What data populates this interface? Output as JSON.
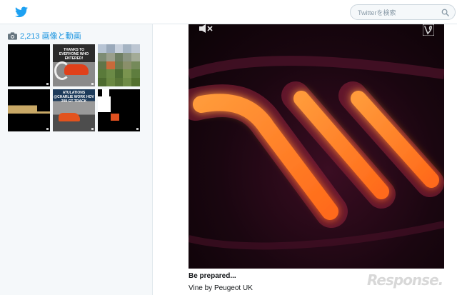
{
  "header": {
    "search_placeholder": "Twitterを検索"
  },
  "media": {
    "count_label": "2,213 画像と動画",
    "thumbs": [
      {
        "kind": "black"
      },
      {
        "kind": "thanks",
        "caption": "THANKS TO EVERYONE WHO ENTERED!"
      },
      {
        "kind": "pixel"
      },
      {
        "kind": "strip"
      },
      {
        "kind": "road",
        "caption": "ATULATIONS @CHARLIE WORK HOV 208 GT TRACK"
      },
      {
        "kind": "block"
      }
    ]
  },
  "tweet": {
    "title": "Be prepared...",
    "source": "Vine by Peugeot UK"
  },
  "watermark": {
    "text": "Response."
  },
  "colors": {
    "twitter_blue": "#1da1f2",
    "link_blue": "#1b95e0",
    "light_orange": "#ff7a2a"
  },
  "icons": [
    "twitter-bird-icon",
    "search-icon",
    "camera-icon",
    "mute-icon",
    "vine-logo-icon"
  ]
}
